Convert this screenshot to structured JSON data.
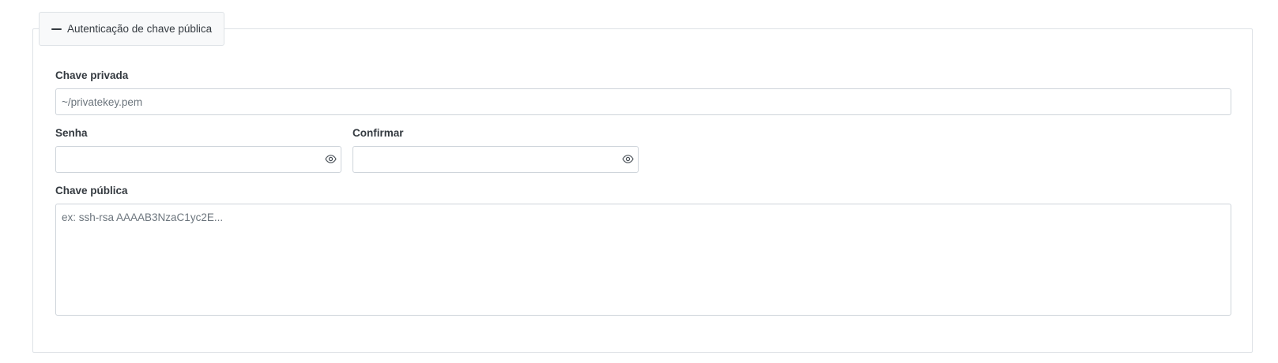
{
  "section": {
    "legend_label": "Autenticação de chave pública"
  },
  "private_key": {
    "label": "Chave privada",
    "value": "",
    "placeholder": "~/privatekey.pem"
  },
  "password": {
    "label": "Senha",
    "value": "",
    "toggle_icon": "eye-icon"
  },
  "confirm": {
    "label": "Confirmar",
    "value": "",
    "toggle_icon": "eye-icon"
  },
  "public_key": {
    "label": "Chave pública",
    "value": "",
    "placeholder": "ex: ssh-rsa AAAAB3NzaC1yc2E..."
  }
}
